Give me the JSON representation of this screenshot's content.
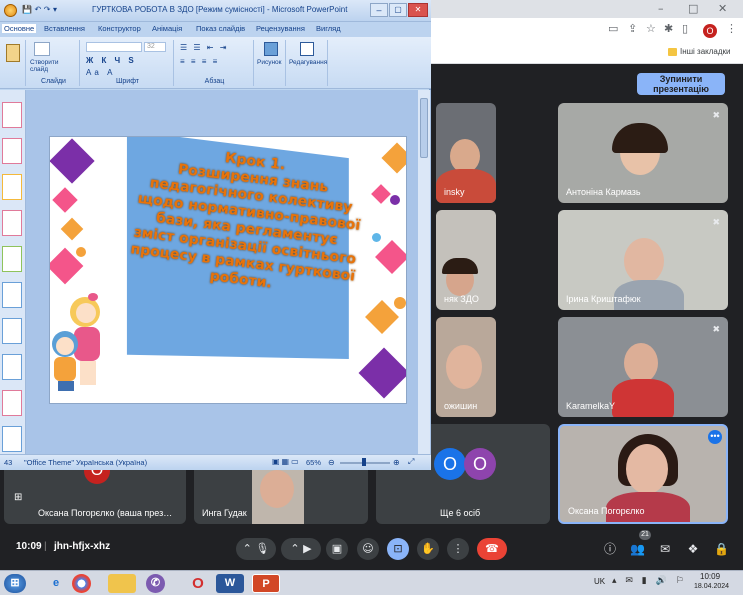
{
  "ppt": {
    "title": "ГУРТКОВА РОБОТА В ЗДО [Режим сумісності] - Microsoft PowerPoint",
    "tabs": [
      "Основне",
      "Вставлення",
      "Конструктор",
      "Анімація",
      "Показ слайдів",
      "Рецензування",
      "Вигляд"
    ],
    "ribbon": {
      "new_slide": "Створити слайд",
      "slides_group": "Слайди",
      "font_group": "Шрифт",
      "paragraph_group": "Абзац",
      "drawing": "Рисунок",
      "editing": "Редагування",
      "font_size": "32"
    },
    "status": {
      "slide_no": "43",
      "theme": "\"Office Theme\"",
      "language": "Українська (Україна)",
      "zoom": "65%"
    },
    "slide": {
      "heading": "Крок 1.",
      "body": "Розширення знань педагогічного колективу щодо нормативно-правової бази, яка регламентує зміст організації освітнього процесу в рамках гурткової роботи."
    }
  },
  "chrome": {
    "profile_initial": "O",
    "bookmarks_label": "Інші закладки"
  },
  "meet": {
    "stop_presenting": "Зупинити презентацію",
    "tiles": [
      {
        "name": "insky"
      },
      {
        "name": "Антоніна Кармазь"
      },
      {
        "name": "няк ЗДО"
      },
      {
        "name": "Ірина Криштафюк"
      },
      {
        "name": "ожишин"
      },
      {
        "name": "KaramelkaY"
      },
      {
        "name": "Ще 6 осіб",
        "avatars": [
          "O",
          "O"
        ]
      },
      {
        "name": "Оксана Погорєлко"
      },
      {
        "name": "Оксана Погорєлко (ваша през…"
      },
      {
        "name": "Инга Гудак"
      }
    ],
    "time": "10:09",
    "meeting_code": "jhn-hfjx-xhz",
    "participants_count": "21"
  },
  "taskbar": {
    "lang": "UK",
    "time": "10:09",
    "date": "18.04.2024"
  }
}
